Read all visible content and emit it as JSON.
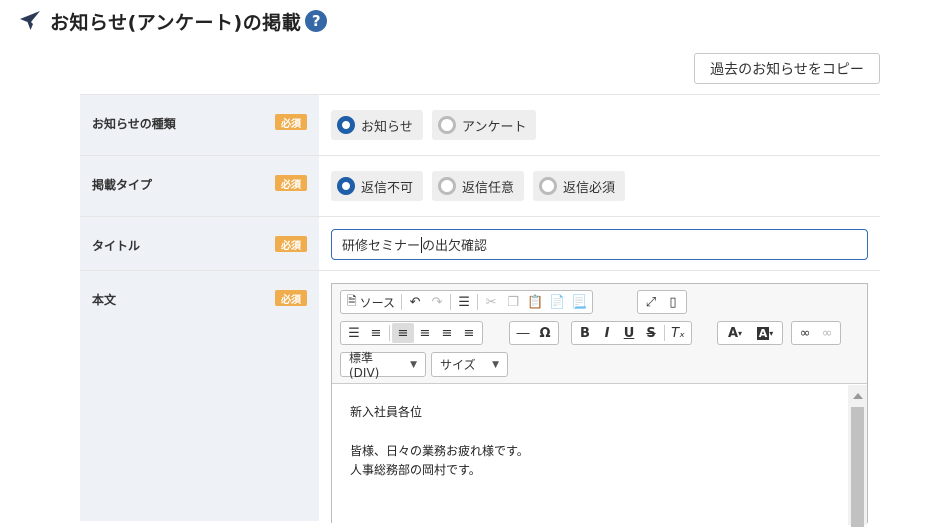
{
  "header": {
    "title": "お知らせ(アンケート)の掲載",
    "help": "?"
  },
  "copy_button": "過去のお知らせをコピー",
  "required": "必須",
  "rows": {
    "type": {
      "label": "お知らせの種類",
      "options": [
        "お知らせ",
        "アンケート"
      ],
      "selected": "お知らせ"
    },
    "post_type": {
      "label": "掲載タイプ",
      "options": [
        "返信不可",
        "返信任意",
        "返信必須"
      ],
      "selected": "返信不可"
    },
    "title": {
      "label": "タイトル",
      "value_before_caret": "研修セミナー",
      "value_after_caret": "の出欠確認"
    },
    "body": {
      "label": "本文"
    }
  },
  "editor": {
    "source_label": "ソース",
    "format_select": "標準 (DIV)",
    "size_select": "サイズ",
    "content": [
      "新入社員各位",
      "",
      "皆様、日々の業務お疲れ様です。",
      "人事総務部の岡村です。"
    ]
  },
  "colors": {
    "accent": "#1f5ea8",
    "badge": "#f0ad4e",
    "label_bg": "#eef1f5",
    "help": "#3468a6"
  }
}
